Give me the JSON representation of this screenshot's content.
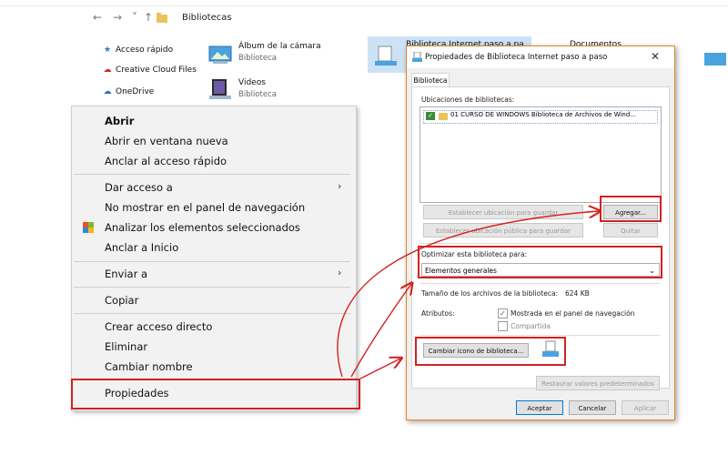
{
  "explorer": {
    "address": "Bibliotecas",
    "nav": [
      "←",
      "→",
      "˅",
      "↑"
    ]
  },
  "nav_pane": [
    {
      "icon": "star-icon",
      "label": "Acceso rápido"
    },
    {
      "icon": "creative-cloud-icon",
      "label": "Creative Cloud Files"
    },
    {
      "icon": "onedrive-cloud-icon",
      "label": "OneDrive"
    }
  ],
  "libraries": [
    {
      "name": "Álbum de la cámara",
      "sub": "Biblioteca"
    },
    {
      "name": "Videos",
      "sub": "Biblioteca"
    },
    {
      "name": "Biblioteca Internet paso a paso",
      "sub": ""
    },
    {
      "name": "Documentos",
      "sub": ""
    }
  ],
  "context_menu": {
    "open": "Abrir",
    "open_new_window": "Abrir en ventana nueva",
    "pin_quick": "Anclar al acceso rápido",
    "give_access": "Dar acceso a",
    "hide_nav": "No mostrar en el panel de navegación",
    "scan": "Analizar los elementos seleccionados",
    "pin_start": "Anclar a Inicio",
    "send_to": "Enviar a",
    "copy": "Copiar",
    "create_shortcut": "Crear acceso directo",
    "delete": "Eliminar",
    "rename": "Cambiar nombre",
    "properties": "Propiedades"
  },
  "dialog": {
    "title": "Propiedades de Biblioteca Internet paso a paso",
    "close": "✕",
    "tab": "Biblioteca",
    "locations_label": "Ubicaciones de bibliotecas:",
    "location_item": "01 CURSO DE WINDOWS Biblioteca de Archivos de Wind...",
    "set_save_location": "Establecer ubicación para guardar",
    "set_public_save_location": "Establecer ubicación pública para guardar",
    "add": "Agregar...",
    "remove": "Quitar",
    "optimize_label": "Optimizar esta biblioteca para:",
    "optimize_value": "Elementos generales",
    "size_label": "Tamaño de los archivos de la biblioteca:",
    "size_value": "624 KB",
    "attributes_label": "Atributos:",
    "shown_in_nav": "Mostrada en el panel de navegación",
    "shared": "Compartida",
    "change_icon": "Cambiar icono de biblioteca...",
    "restore_defaults": "Restaurar valores predeterminados",
    "accept": "Aceptar",
    "cancel": "Cancelar",
    "apply": "Aplicar"
  },
  "colors": {
    "highlight": "#d42020",
    "dialog_border": "#e0861f",
    "selection": "#cde3f5"
  }
}
